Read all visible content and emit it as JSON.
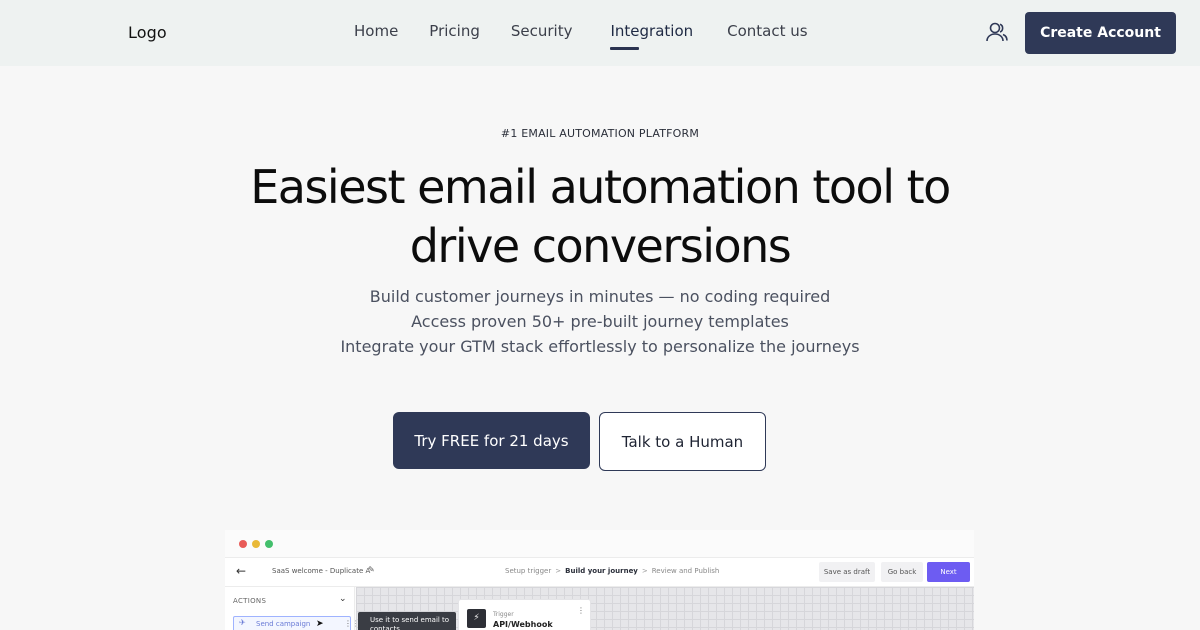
{
  "navbar": {
    "logo": "Logo",
    "links": [
      "Home",
      "Pricing",
      "Security",
      "Integration",
      "Contact us"
    ],
    "active_link": "Integration",
    "user_icon": "users-icon",
    "create_account": "Create Account"
  },
  "hero": {
    "eyebrow": "#1 EMAIL AUTOMATION PLATFORM",
    "headline_line1": "Easiest email automation tool to",
    "headline_line2": "drive conversions",
    "sublines": [
      "Build customer journeys in minutes — no coding required",
      "Access proven 50+ pre-built journey templates",
      "Integrate your GTM stack effortlessly to personalize the journeys"
    ],
    "primary_cta": "Try FREE for 21 days",
    "secondary_cta": "Talk to a Human"
  },
  "preview": {
    "window_dots": [
      "#e95b58",
      "#e9b938",
      "#43bf6c"
    ],
    "back_icon": "arrow-left-icon",
    "title": "SaaS welcome - Duplicate A",
    "edit_icon": "pencil-icon",
    "breadcrumbs": [
      "Setup trigger",
      "Build your journey",
      "Review and Publish"
    ],
    "active_breadcrumb": "Build your journey",
    "save_draft": "Save as draft",
    "go_back": "Go back",
    "next": "Next",
    "sidebar_section": "ACTIONS",
    "sidebar_item": "Send campaign",
    "tooltip": "Use it to send email to contacts",
    "trigger_label": "Trigger",
    "trigger_value": "API/Webhook"
  },
  "colors": {
    "brand_dark": "#2f3957",
    "accent_purple": "#6d5cf2",
    "navbar_bg": "#eef2f1",
    "page_bg": "#f7f7f7"
  }
}
